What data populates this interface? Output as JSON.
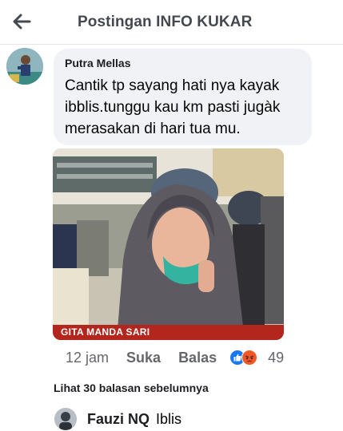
{
  "header": {
    "back_icon": "arrow-left-icon",
    "title": "Postingan INFO KUKAR"
  },
  "comment": {
    "author": "Putra Mellas",
    "text_lines": [
      "Cantik tp sayang hati nya kayak",
      "ibblis.tunggu kau km pasti jugàk",
      "merasakan di hari tua mu."
    ],
    "photo_caption": "GITA MANDA SARI",
    "time": "12 jam",
    "like_label": "Suka",
    "reply_label": "Balas",
    "reaction_icons": [
      "like-reaction-icon",
      "angry-reaction-icon"
    ],
    "reaction_count": "49"
  },
  "replies": {
    "more_label": "Lihat 30 balasan sebelumnya",
    "latest": {
      "author": "Fauzi NQ",
      "text": "Iblis"
    }
  },
  "colors": {
    "like_blue": "#1877f2",
    "angry_orange": "#f0582a",
    "caption_red": "#b3261e",
    "bubble_gray": "#f0f2f5"
  }
}
